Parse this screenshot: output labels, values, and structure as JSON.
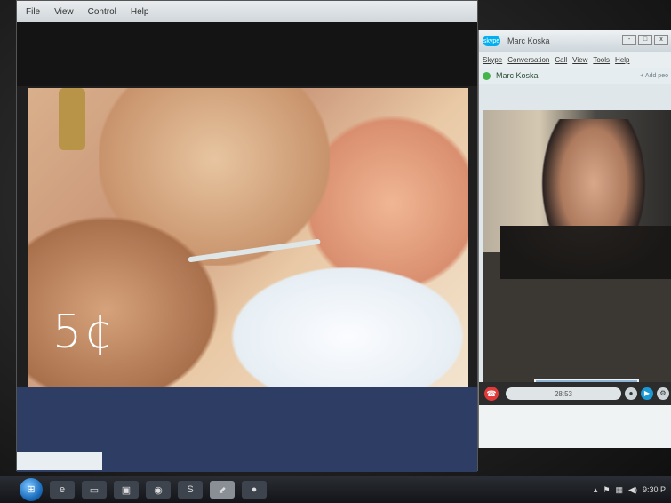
{
  "player": {
    "menu": [
      "File",
      "View",
      "Control",
      "Help"
    ],
    "video_overlay_text": "5¢"
  },
  "skype": {
    "logo": "skype",
    "title": "Marc Koska",
    "window_buttons": [
      "-",
      "□",
      "x"
    ],
    "menu": [
      "Skype",
      "Conversation",
      "Call",
      "View",
      "Tools",
      "Help"
    ],
    "contact_name": "Marc Koska",
    "add_people": "+ Add peo",
    "timer": "28:53",
    "toolbar_icons": [
      "hangup-icon",
      "mic-icon",
      "video-icon",
      "settings-icon"
    ]
  },
  "taskbar": {
    "apps": [
      "ie-icon",
      "explorer-icon",
      "media-icon",
      "chrome-icon",
      "skype-icon",
      "pdf-icon",
      "record-icon"
    ],
    "clock": "9:30 P"
  },
  "colors": {
    "skype_blue": "#00aff0",
    "status_green": "#45b44b",
    "hangup_red": "#e23a3a"
  }
}
